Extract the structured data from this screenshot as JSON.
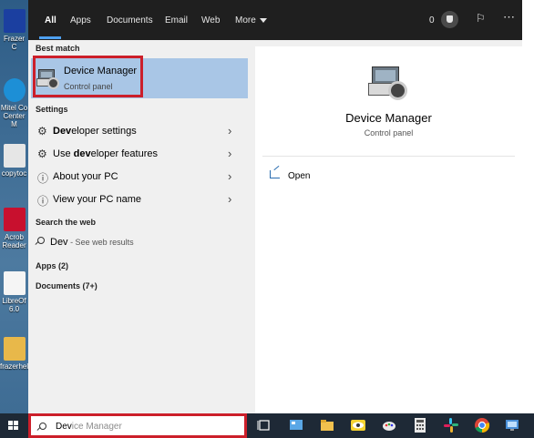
{
  "desktop": {
    "icons": [
      {
        "label": "Frazer C",
        "color": "#1b3fa0"
      },
      {
        "label": "Mitel Co Center M",
        "color": "#1d8fd6"
      },
      {
        "label": "copytoc",
        "color": "#e6e6e6"
      },
      {
        "label": "Acrob Reader",
        "color": "#c8102e"
      },
      {
        "label": "LibreOf 6.0",
        "color": "#f5f5f5"
      },
      {
        "label": "frazerhel",
        "color": "#e8b84a"
      }
    ]
  },
  "search_tabs": [
    "All",
    "Apps",
    "Documents",
    "Email",
    "Web"
  ],
  "more_label": "More",
  "reward_count": "0",
  "best_match": {
    "heading": "Best match",
    "title": "Device Manager",
    "subtitle": "Control panel"
  },
  "settings": {
    "heading": "Settings",
    "items": [
      {
        "bold": "Dev",
        "rest": "eloper settings",
        "icon": "gear-icon"
      },
      {
        "pre": "Use ",
        "bold": "dev",
        "rest": "eloper features",
        "icon": "gear-icon"
      },
      {
        "label": "About your PC",
        "icon": "info-icon"
      },
      {
        "label": "View your PC name",
        "icon": "info-icon"
      }
    ]
  },
  "web": {
    "heading": "Search the web",
    "query": "Dev",
    "suffix": " - See web results"
  },
  "apps_count_label": "Apps (2)",
  "documents_count_label": "Documents (7+)",
  "preview": {
    "title": "Device Manager",
    "subtitle": "Control panel",
    "open_label": "Open"
  },
  "taskbar": {
    "query_typed": "Dev",
    "query_suggested": "ice Manager"
  },
  "colors": {
    "highlight": "#a9c6e6",
    "outline_red": "#cc1f2a",
    "dark_bar": "#1f1f1f",
    "taskbar": "#1e2936"
  }
}
